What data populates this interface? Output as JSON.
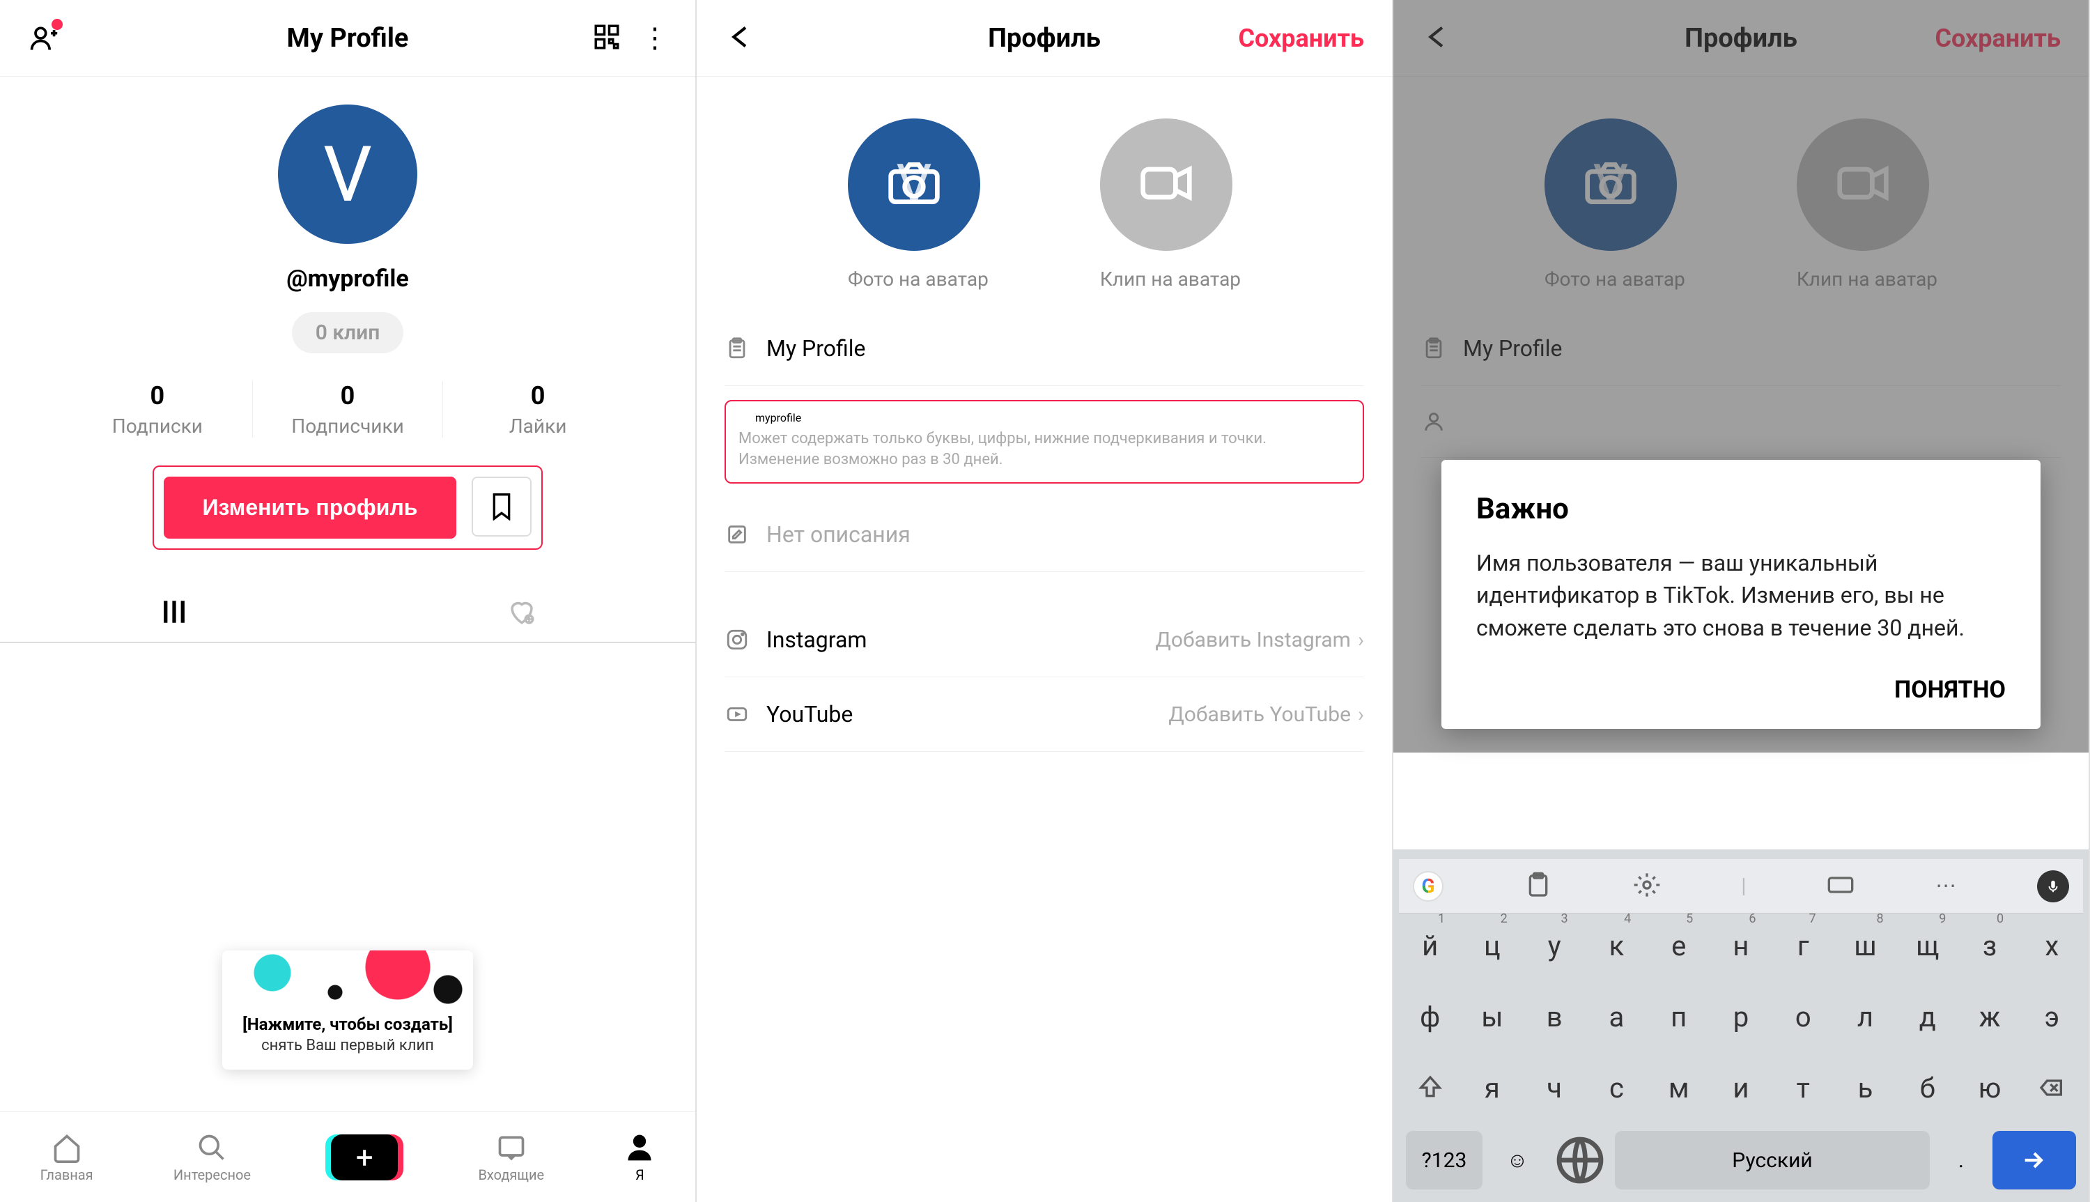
{
  "panel1": {
    "header_title": "My Profile",
    "avatar_letter": "V",
    "username": "@myprofile",
    "clip_pill": "0 клип",
    "stats": [
      {
        "num": "0",
        "label": "Подписки"
      },
      {
        "num": "0",
        "label": "Подписчики"
      },
      {
        "num": "0",
        "label": "Лайки"
      }
    ],
    "edit_button": "Изменить профиль",
    "prompt_line1": "[Нажмите, чтобы создать]",
    "prompt_line2": "снять Ваш первый клип",
    "nav": {
      "home": "Главная",
      "discover": "Интересное",
      "inbox": "Входящие",
      "me": "Я"
    }
  },
  "panel2": {
    "header_title": "Профиль",
    "save": "Сохранить",
    "avatar_letter": "V",
    "avatar_photo_caption": "Фото на аватар",
    "avatar_clip_caption": "Клип на аватар",
    "name_value": "My Profile",
    "username_value": "myprofile",
    "username_hint": "Может содержать только буквы, цифры, нижние подчеркивания и точки. Изменение возможно раз в 30 дней.",
    "bio_placeholder": "Нет описания",
    "instagram_label": "Instagram",
    "instagram_action": "Добавить Instagram",
    "youtube_label": "YouTube",
    "youtube_action": "Добавить YouTube"
  },
  "panel3": {
    "header_title": "Профиль",
    "save": "Сохранить",
    "avatar_letter": "V",
    "avatar_photo_caption": "Фото на аватар",
    "avatar_clip_caption": "Клип на аватар",
    "name_value": "My Profile",
    "dialog_title": "Важно",
    "dialog_body": "Имя пользователя — ваш уникальный идентификатор в TikTok. Изменив его, вы не сможете сделать это снова в течение 30 дней.",
    "dialog_ok": "ПОНЯТНО",
    "keyboard": {
      "nums": [
        "1",
        "2",
        "3",
        "4",
        "5",
        "6",
        "7",
        "8",
        "9",
        "0"
      ],
      "row1": [
        "й",
        "ц",
        "у",
        "к",
        "е",
        "н",
        "г",
        "ш",
        "щ",
        "з",
        "х"
      ],
      "row2": [
        "ф",
        "ы",
        "в",
        "а",
        "п",
        "р",
        "о",
        "л",
        "д",
        "ж",
        "э"
      ],
      "row3": [
        "я",
        "ч",
        "с",
        "м",
        "и",
        "т",
        "ь",
        "б",
        "ю"
      ],
      "sym": "?123",
      "lang": "Русский",
      "dot": "."
    }
  }
}
